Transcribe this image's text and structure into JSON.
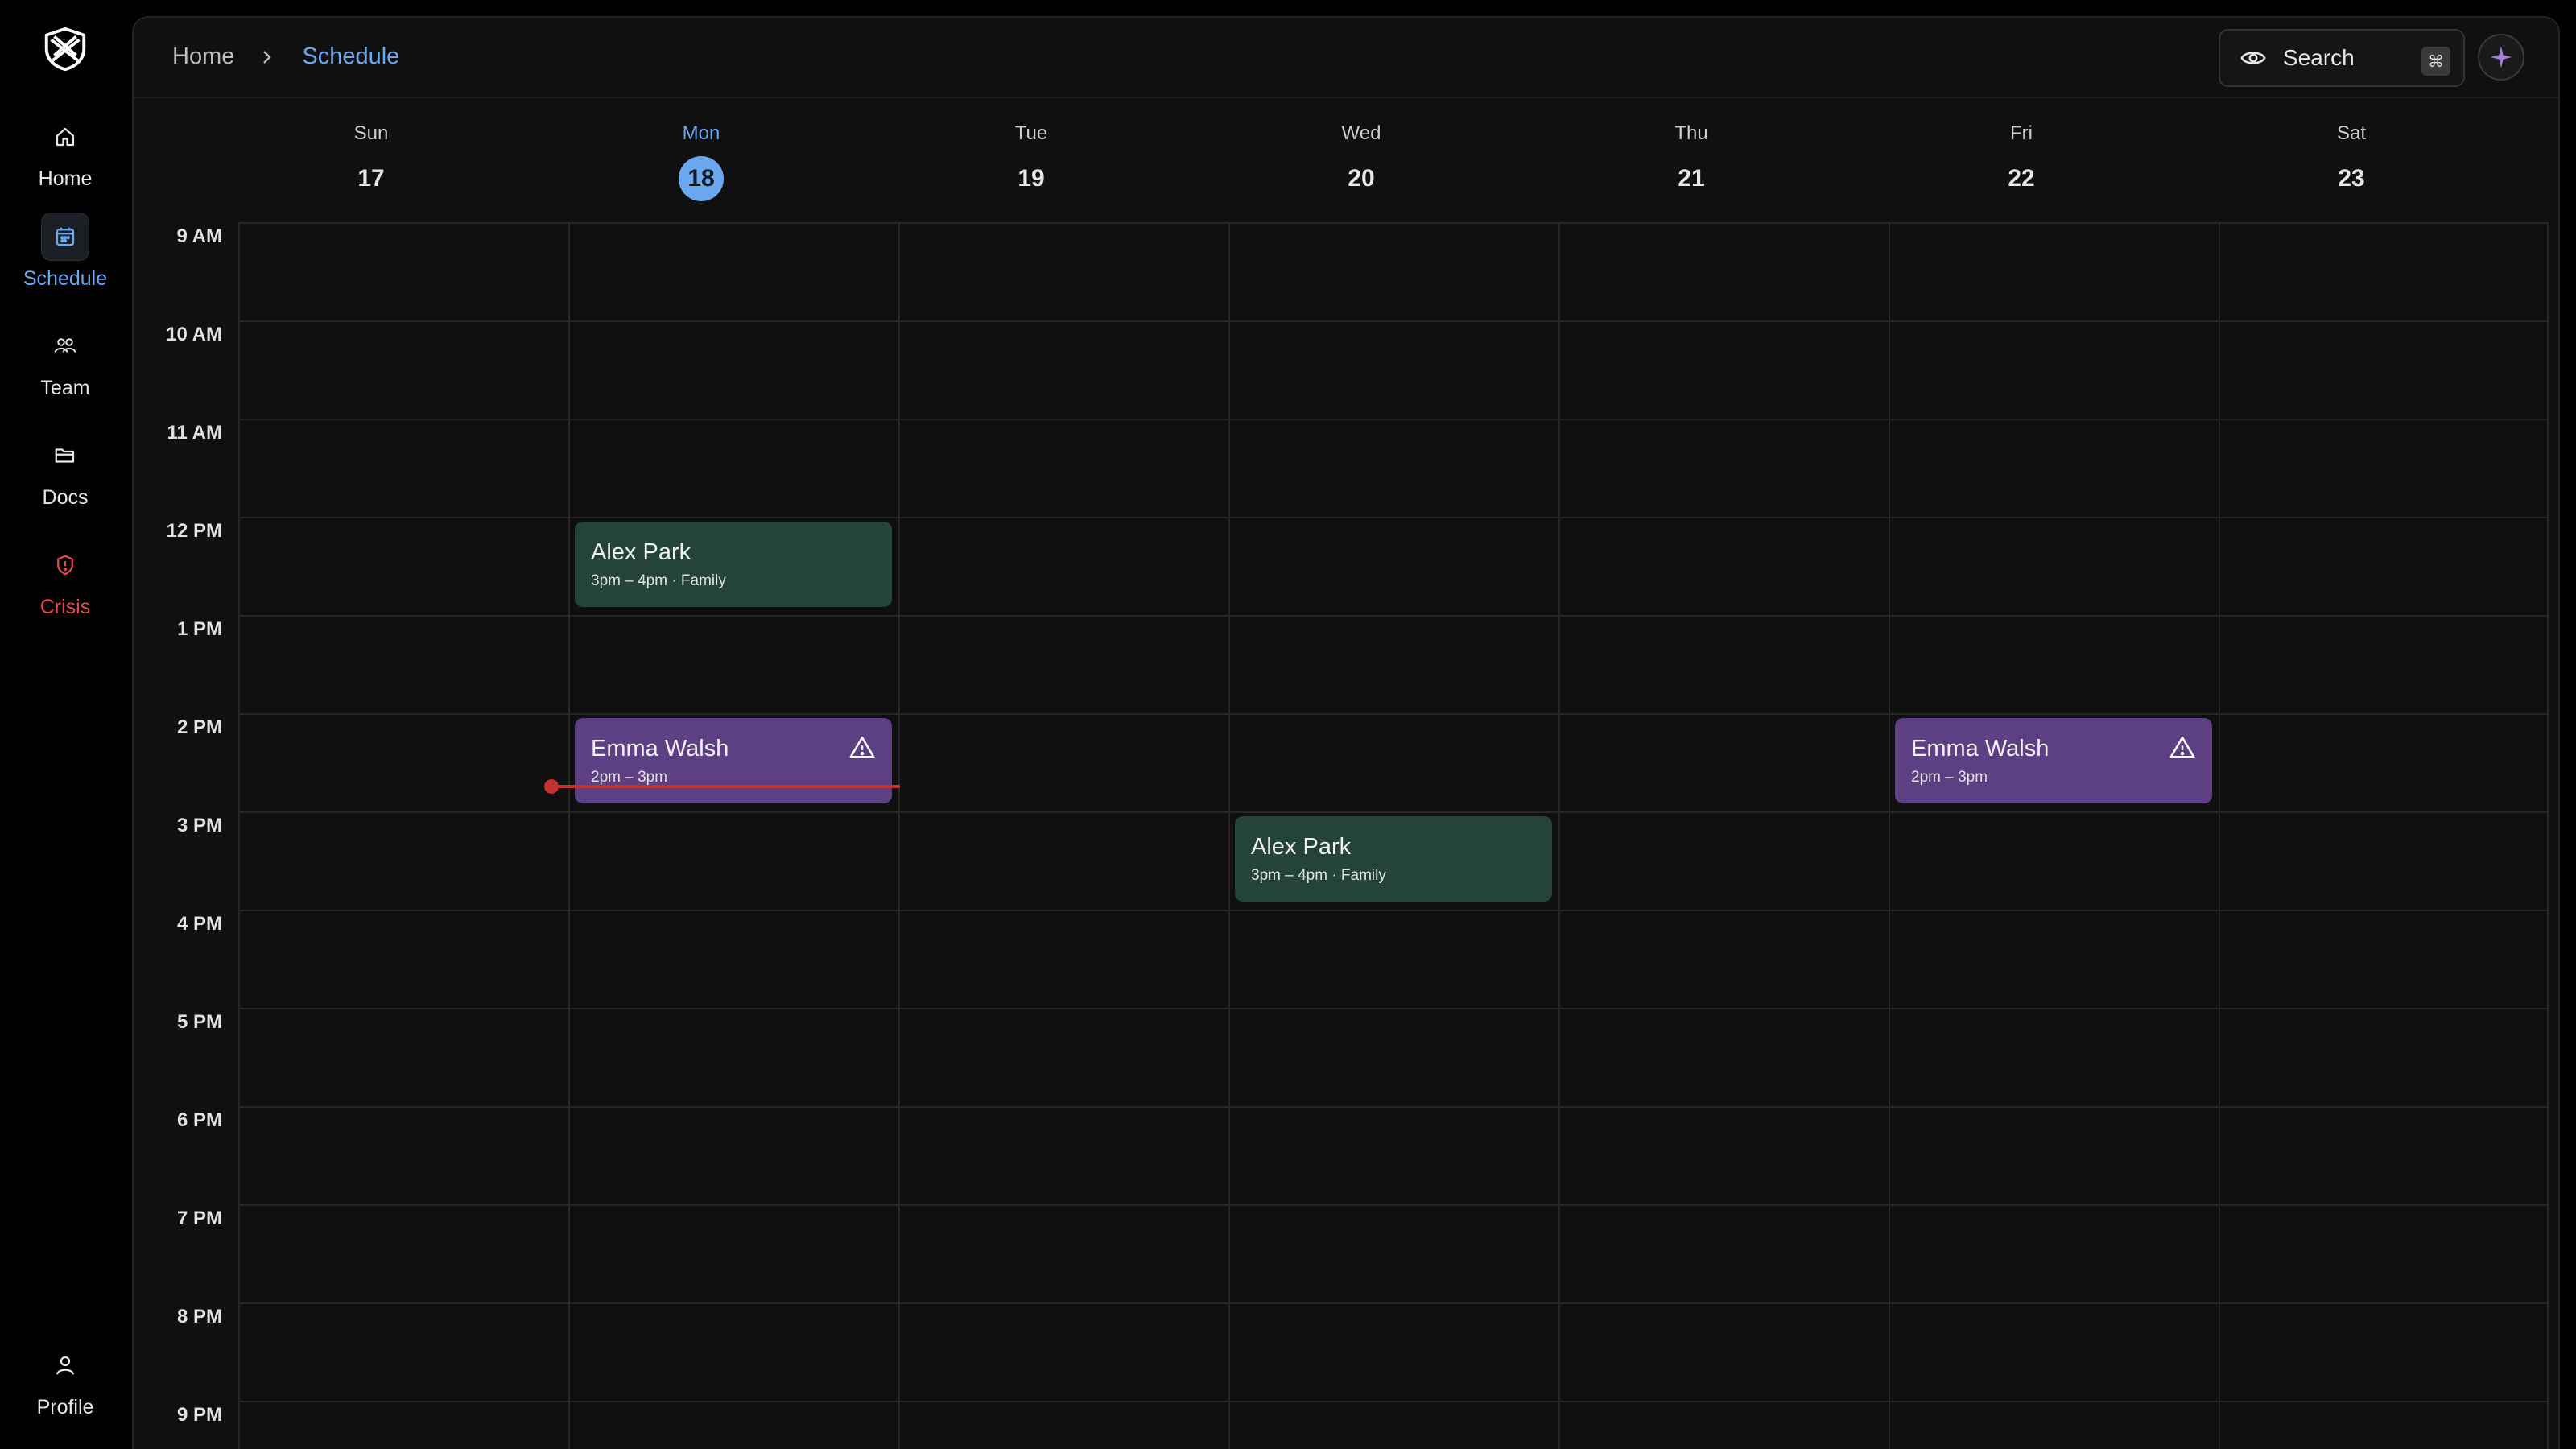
{
  "sidebar": {
    "items": [
      {
        "label": "Home",
        "icon": "home-icon"
      },
      {
        "label": "Schedule",
        "icon": "calendar-icon"
      },
      {
        "label": "Team",
        "icon": "team-icon"
      },
      {
        "label": "Docs",
        "icon": "folder-icon"
      },
      {
        "label": "Crisis",
        "icon": "shield-alert-icon"
      },
      {
        "label": "Profile",
        "icon": "user-icon"
      }
    ],
    "active": "Schedule"
  },
  "breadcrumb": {
    "home": "Home",
    "current": "Schedule"
  },
  "search": {
    "label": "Search",
    "shortcut": "⌘"
  },
  "days": [
    {
      "name": "Sun",
      "num": "17"
    },
    {
      "name": "Mon",
      "num": "18",
      "today": true
    },
    {
      "name": "Tue",
      "num": "19"
    },
    {
      "name": "Wed",
      "num": "20"
    },
    {
      "name": "Thu",
      "num": "21"
    },
    {
      "name": "Fri",
      "num": "22"
    },
    {
      "name": "Sat",
      "num": "23"
    }
  ],
  "hours": [
    "9 AM",
    "10 AM",
    "11 AM",
    "12 PM",
    "1 PM",
    "2 PM",
    "3 PM",
    "4 PM",
    "5 PM",
    "6 PM",
    "7 PM",
    "8 PM",
    "9 PM"
  ],
  "events": [
    {
      "name": "Alex Park",
      "time": "3pm – 4pm · Family",
      "color": "#23433b"
    },
    {
      "name": "Emma Walsh",
      "time": "2pm – 3pm",
      "color": "#5d3f83",
      "warning": true
    },
    {
      "name": "Alex Park",
      "time": "3pm – 4pm · Family",
      "color": "#23433b"
    },
    {
      "name": "Emma Walsh",
      "time": "2pm – 3pm",
      "color": "#5d3f83",
      "warning": true
    }
  ],
  "colors": {
    "accent": "#6aa8ef",
    "danger": "#e5484d",
    "now_line": "#c43030"
  }
}
